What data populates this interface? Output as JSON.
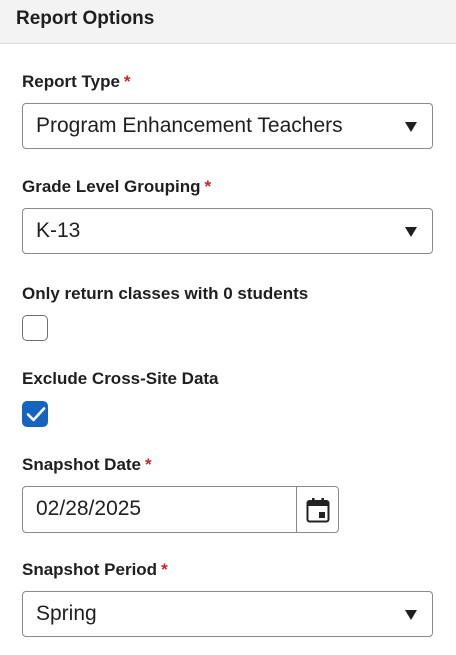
{
  "header": {
    "title": "Report Options"
  },
  "fields": {
    "report_type": {
      "label": "Report Type",
      "required_mark": "*",
      "value": "Program Enhancement Teachers"
    },
    "grade_level_grouping": {
      "label": "Grade Level Grouping",
      "required_mark": "*",
      "value": "K-13"
    },
    "only_zero_students": {
      "label": "Only return classes with 0 students",
      "checked": false
    },
    "exclude_cross_site": {
      "label": "Exclude Cross-Site Data",
      "checked": true
    },
    "snapshot_date": {
      "label": "Snapshot Date",
      "required_mark": "*",
      "value": "02/28/2025",
      "icon": "calendar-icon"
    },
    "snapshot_period": {
      "label": "Snapshot Period",
      "required_mark": "*",
      "value": "Spring"
    }
  },
  "colors": {
    "required": "#c62828",
    "checkbox_checked": "#1565c0",
    "header_bg": "#f3f3f3"
  }
}
